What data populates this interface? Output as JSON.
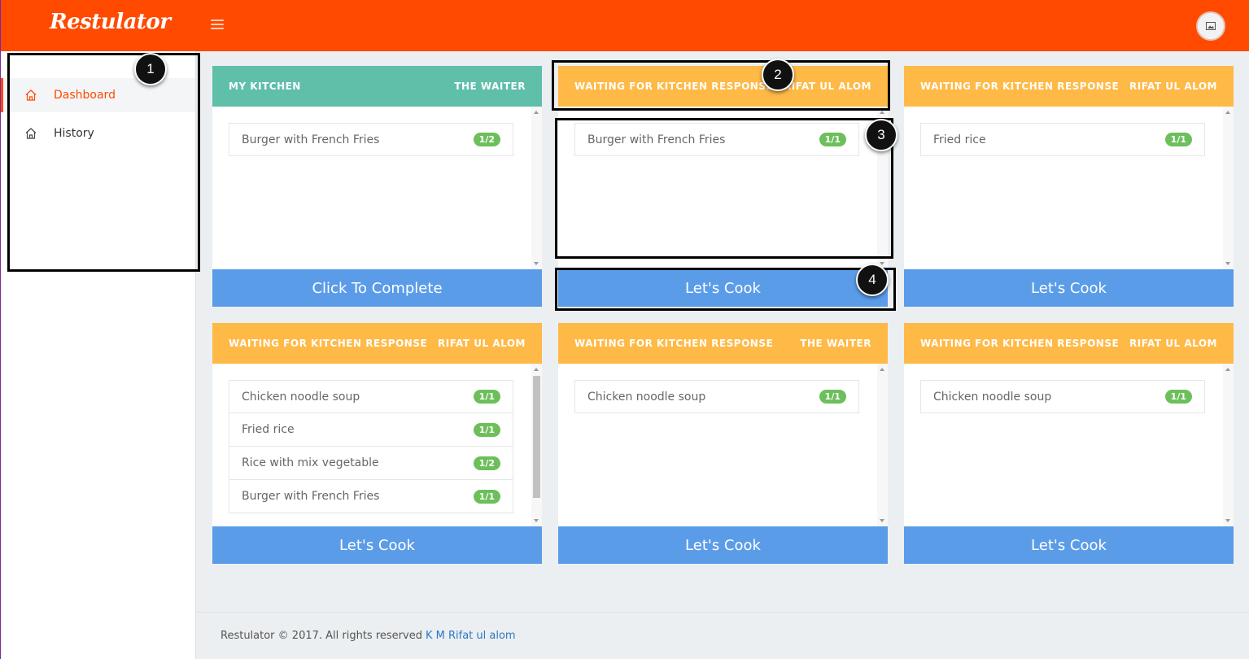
{
  "app": {
    "brand": "Restulator"
  },
  "sidebar": {
    "items": [
      {
        "label": "Dashboard",
        "active": true,
        "icon": "home-icon"
      },
      {
        "label": "History",
        "active": false,
        "icon": "home-icon"
      }
    ]
  },
  "cards": [
    {
      "status": "MY KITCHEN",
      "waiter": "THE WAITER",
      "color": "#5fbfa9",
      "items": [
        {
          "name": "Burger with French Fries",
          "qty": "1/2"
        }
      ],
      "button": "Click To Complete"
    },
    {
      "status": "WAITING FOR KITCHEN RESPONSE",
      "waiter": "RIFAT UL ALOM",
      "color": "#ffb946",
      "items": [
        {
          "name": "Burger with French Fries",
          "qty": "1/1"
        }
      ],
      "button": "Let's Cook"
    },
    {
      "status": "WAITING FOR KITCHEN RESPONSE",
      "waiter": "RIFAT UL ALOM",
      "color": "#ffb946",
      "items": [
        {
          "name": "Fried rice",
          "qty": "1/1"
        }
      ],
      "button": "Let's Cook"
    },
    {
      "status": "WAITING FOR KITCHEN RESPONSE",
      "waiter": "RIFAT UL ALOM",
      "color": "#ffb946",
      "items": [
        {
          "name": "Chicken noodle soup",
          "qty": "1/1"
        },
        {
          "name": "Fried rice",
          "qty": "1/1"
        },
        {
          "name": "Rice with mix vegetable",
          "qty": "1/2"
        },
        {
          "name": "Burger with French Fries",
          "qty": "1/1"
        }
      ],
      "button": "Let's Cook"
    },
    {
      "status": "WAITING FOR KITCHEN RESPONSE",
      "waiter": "THE WAITER",
      "color": "#ffb946",
      "items": [
        {
          "name": "Chicken noodle soup",
          "qty": "1/1"
        }
      ],
      "button": "Let's Cook"
    },
    {
      "status": "WAITING FOR KITCHEN RESPONSE",
      "waiter": "RIFAT UL ALOM",
      "color": "#ffb946",
      "items": [
        {
          "name": "Chicken noodle soup",
          "qty": "1/1"
        }
      ],
      "button": "Let's Cook"
    }
  ],
  "annotations": {
    "a1": "1",
    "a2": "2",
    "a3": "3",
    "a4": "4"
  },
  "footer": {
    "text": "Restulator © 2017. All rights reserved",
    "link": "K M Rifat ul alom"
  },
  "colors": {
    "topbar": "#ff4a00",
    "button": "#5b9ce8",
    "badge": "#6cbf5a",
    "green_header": "#5fbfa9",
    "yellow_header": "#ffb946"
  }
}
